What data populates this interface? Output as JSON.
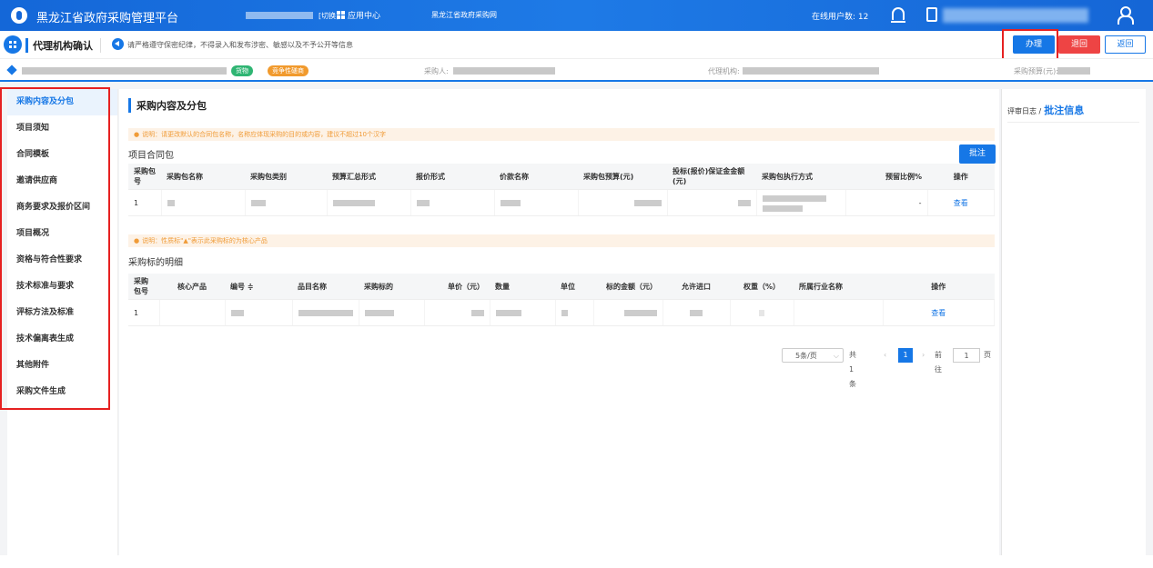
{
  "topbar": {
    "title": "黑龙江省政府采购管理平台",
    "switch_label": "[切换]",
    "apps_label": "应用中心",
    "site_label": "黑龙江省政府采购网",
    "online_users_label": "在线用户数: 12"
  },
  "header": {
    "page_title": "代理机构确认",
    "notice": "请严格遵守保密纪律，不得录入和发布涉密、敏感以及不予公开等信息",
    "buttons": {
      "handle": "办理",
      "return": "退回",
      "back": "返回"
    }
  },
  "project_bar": {
    "tag_goods": "货物",
    "tag_method": "竞争性磋商",
    "buyer_label": "采购人:",
    "agency_label": "代理机构:",
    "budget_label": "采购预算(元):"
  },
  "sidebar": {
    "items": [
      {
        "label": "采购内容及分包",
        "active": true
      },
      {
        "label": "项目须知"
      },
      {
        "label": "合同模板"
      },
      {
        "label": "邀请供应商"
      },
      {
        "label": "商务要求及报价区间"
      },
      {
        "label": "项目概况"
      },
      {
        "label": "资格与符合性要求"
      },
      {
        "label": "技术标准与要求"
      },
      {
        "label": "评标方法及标准"
      },
      {
        "label": "技术偏离表生成"
      },
      {
        "label": "其他附件"
      },
      {
        "label": "采购文件生成"
      }
    ]
  },
  "main": {
    "section_title": "采购内容及分包",
    "tip1": "说明：请更改默认的合同包名称，名称应体现采购的目的或内容，建议不超过10个汉字",
    "package_title": "项目合同包",
    "annotate_label": "批注",
    "package_table": {
      "headers": [
        "采购包号",
        "采购包名称",
        "采购包类别",
        "预算汇总形式",
        "报价形式",
        "价款名称",
        "采购包预算(元)",
        "投标(报价)保证金金额(元)",
        "采购包执行方式",
        "预留比例%",
        "操作"
      ],
      "row": {
        "no": "1",
        "reserve": "-",
        "action": "查看"
      }
    },
    "tip2": "说明：性质标\"▲\"表示此采购标的为核心产品",
    "detail_title": "采购标的明细",
    "detail_table": {
      "headers": [
        "采购包号",
        "核心产品",
        "编号 ≑",
        "品目名称",
        "采购标的",
        "单价（元）",
        "数量",
        "单位",
        "标的金额（元）",
        "允许进口",
        "权重（%）",
        "所属行业名称",
        "操作"
      ],
      "row": {
        "no": "1",
        "action": "查看"
      }
    },
    "pagination": {
      "page_size": "5条/页",
      "total": "共 1 条",
      "current_page": "1",
      "goto_label": "前往",
      "goto_value": "1",
      "page_suffix": "页"
    }
  },
  "right_panel": {
    "log_label": "评审日志 /",
    "annotation_label": "批注信息"
  }
}
